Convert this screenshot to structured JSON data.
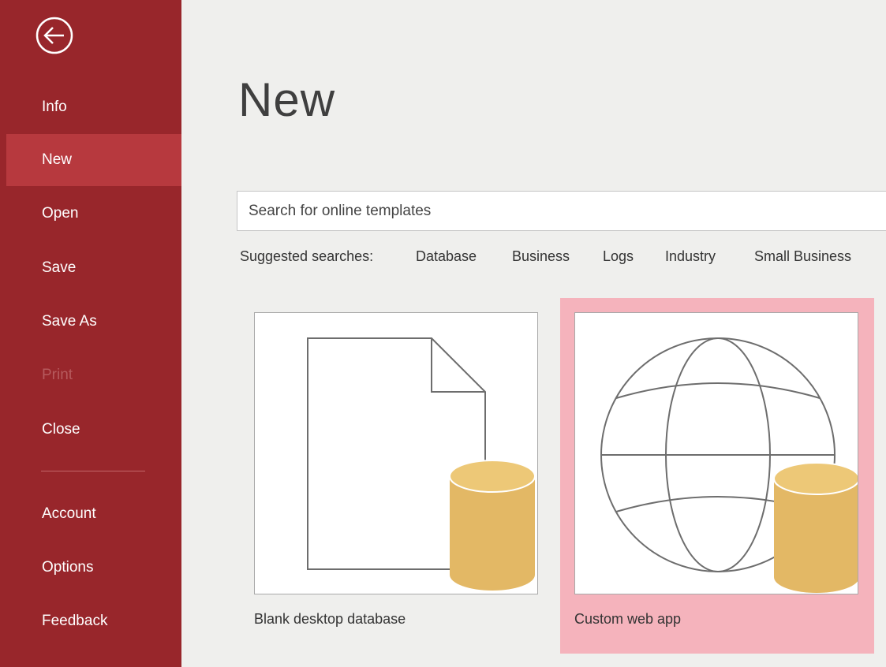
{
  "sidebar": {
    "back_icon": "back-arrow-icon",
    "items": [
      {
        "label": "Info"
      },
      {
        "label": "New"
      },
      {
        "label": "Open"
      },
      {
        "label": "Save"
      },
      {
        "label": "Save As"
      },
      {
        "label": "Print"
      },
      {
        "label": "Close"
      },
      {
        "label": "Account"
      },
      {
        "label": "Options"
      },
      {
        "label": "Feedback"
      }
    ],
    "selected": "New",
    "disabled": [
      "Print"
    ]
  },
  "main": {
    "title": "New",
    "search": {
      "placeholder": "Search for online templates"
    },
    "suggested": {
      "label": "Suggested searches:",
      "links": [
        "Database",
        "Business",
        "Logs",
        "Industry",
        "Small Business"
      ]
    },
    "templates": [
      {
        "label": "Blank desktop database",
        "icon": "blank-document-database-icon"
      },
      {
        "label": "Custom web app",
        "icon": "globe-database-icon",
        "highlighted": true
      }
    ]
  },
  "colors": {
    "sidebar_bg": "#98262b",
    "sidebar_selected": "#b7393e",
    "highlight": "#f5b3bc",
    "database_gold": "#e3b865"
  }
}
